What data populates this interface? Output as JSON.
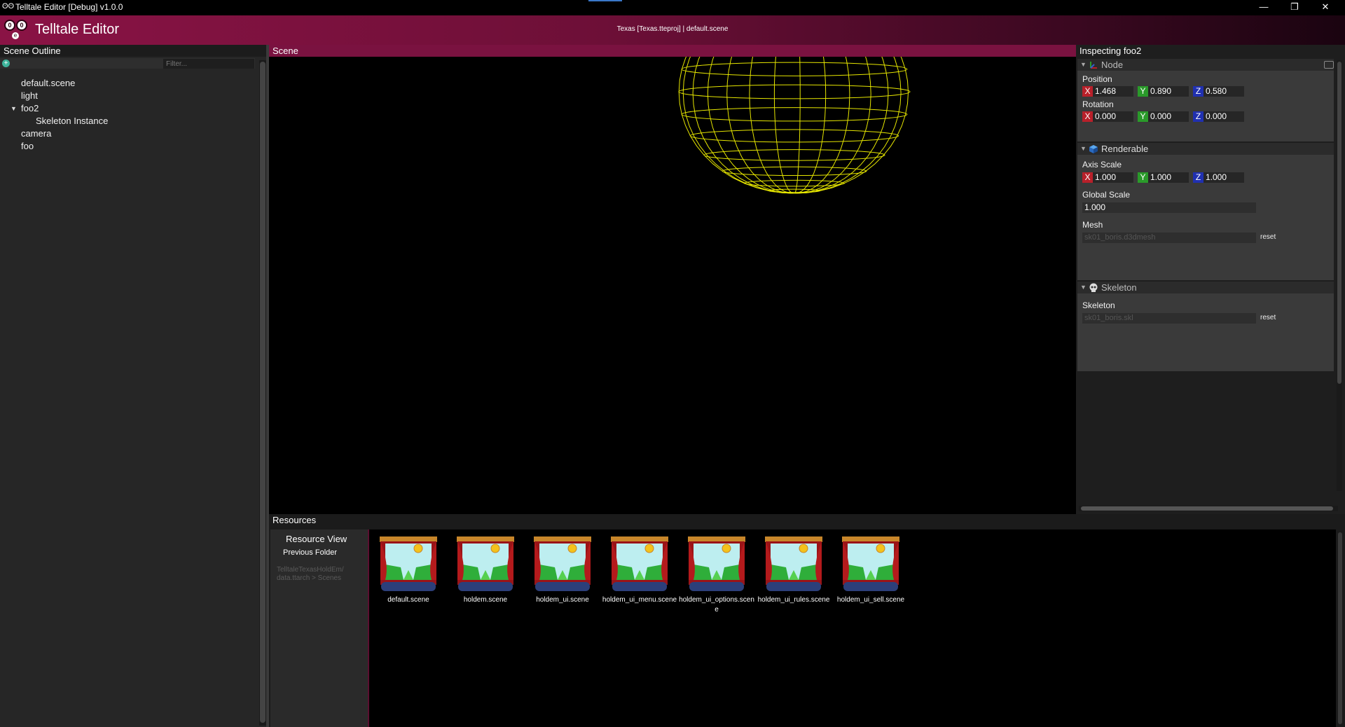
{
  "window": {
    "title": "Telltale Editor [Debug] v1.0.0",
    "minimize": "—",
    "restore": "❐",
    "close": "✕"
  },
  "header": {
    "brand": "Telltale Editor",
    "project": "Texas [Texas.tteproj] | default.scene",
    "logo_letters": {
      "left": "0",
      "right": "0",
      "nose": "e"
    }
  },
  "outline": {
    "title": "Scene Outline",
    "filter_placeholder": "Filter...",
    "add_icon": "+",
    "items": [
      {
        "label": "default.scene"
      },
      {
        "label": "light"
      },
      {
        "label": "foo2",
        "expanded": true
      },
      {
        "label": "Skeleton Instance"
      },
      {
        "label": "camera"
      },
      {
        "label": "foo"
      }
    ]
  },
  "scene": {
    "title": "Scene",
    "wireframe_color": "#e6e600"
  },
  "inspector": {
    "title": "Inspecting foo2",
    "node": {
      "header": "Node",
      "position_label": "Position",
      "position": {
        "x": "1.468",
        "y": "0.890",
        "z": "0.580"
      },
      "rotation_label": "Rotation",
      "rotation": {
        "x": "0.000",
        "y": "0.000",
        "z": "0.000"
      }
    },
    "renderable": {
      "header": "Renderable",
      "axis_scale_label": "Axis Scale",
      "axis_scale": {
        "x": "1.000",
        "y": "1.000",
        "z": "1.000"
      },
      "global_scale_label": "Global Scale",
      "global_scale": "1.000",
      "mesh_label": "Mesh",
      "mesh_value": "sk01_boris.d3dmesh",
      "reset": "reset"
    },
    "skeleton": {
      "header": "Skeleton",
      "skeleton_label": "Skeleton",
      "skeleton_value": "sk01_boris.skl",
      "reset": "reset"
    },
    "axis_letters": {
      "x": "X",
      "y": "Y",
      "z": "Z"
    }
  },
  "resources": {
    "title": "Resources",
    "view_title": "Resource View",
    "previous_folder": "Previous Folder",
    "path": "TelltaleTexasHoldEm/ data.ttarch > Scenes",
    "files": [
      "default.scene",
      "holdem.scene",
      "holdem_ui.scene",
      "holdem_ui_menu.scene",
      "holdem_ui_options.scene",
      "holdem_ui_rules.scene",
      "holdem_ui_sell.scene"
    ]
  },
  "colors": {
    "accent": "#7a1240",
    "header_start": "#8a1345",
    "axis_x": "#b8202a",
    "axis_y": "#2a9a2a",
    "axis_z": "#2030b0"
  }
}
